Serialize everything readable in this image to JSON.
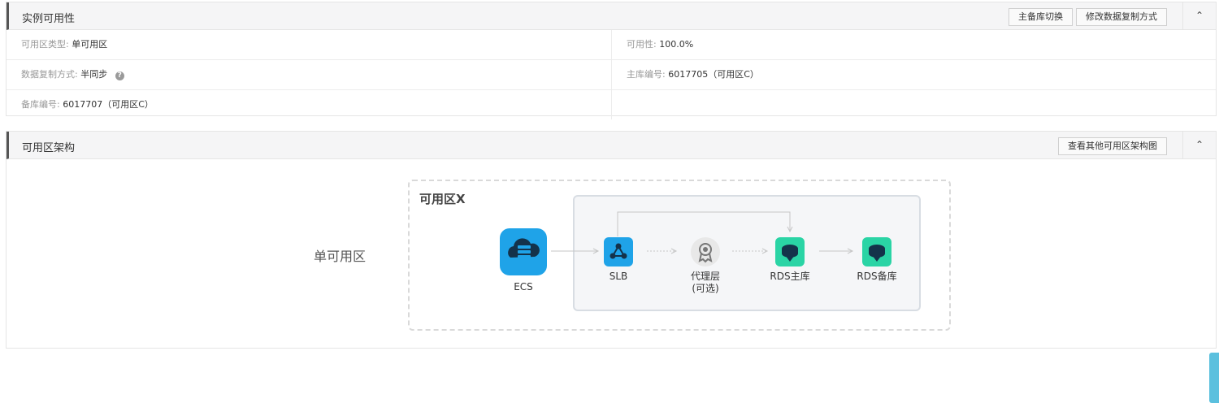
{
  "availability": {
    "title": "实例可用性",
    "btn_switch": "主备库切换",
    "btn_modify": "修改数据复制方式",
    "rows": {
      "zone_type_key": "可用区类型:",
      "zone_type_val": "单可用区",
      "availability_key": "可用性:",
      "availability_val": "100.0%",
      "replication_key": "数据复制方式:",
      "replication_val": "半同步",
      "primary_key": "主库编号:",
      "primary_val": "6017705（可用区C）",
      "standby_key": "备库编号:",
      "standby_val": "6017707（可用区C）"
    }
  },
  "architecture": {
    "title": "可用区架构",
    "btn_other": "查看其他可用区架构图",
    "single_zone": "单可用区",
    "zone_name": "可用区X",
    "nodes": {
      "ecs": "ECS",
      "slb": "SLB",
      "proxy_line1": "代理层",
      "proxy_line2": "(可选)",
      "rds_primary": "RDS主库",
      "rds_standby": "RDS备库"
    }
  },
  "colors": {
    "accent_blue": "#1fa3e8",
    "accent_green": "#2ad4a5",
    "proxy_gray": "#d8d8d8"
  },
  "icons": [
    "chevron-up-icon",
    "help-icon",
    "cloud-server-icon",
    "load-balancer-icon",
    "proxy-badge-icon",
    "database-icon"
  ]
}
